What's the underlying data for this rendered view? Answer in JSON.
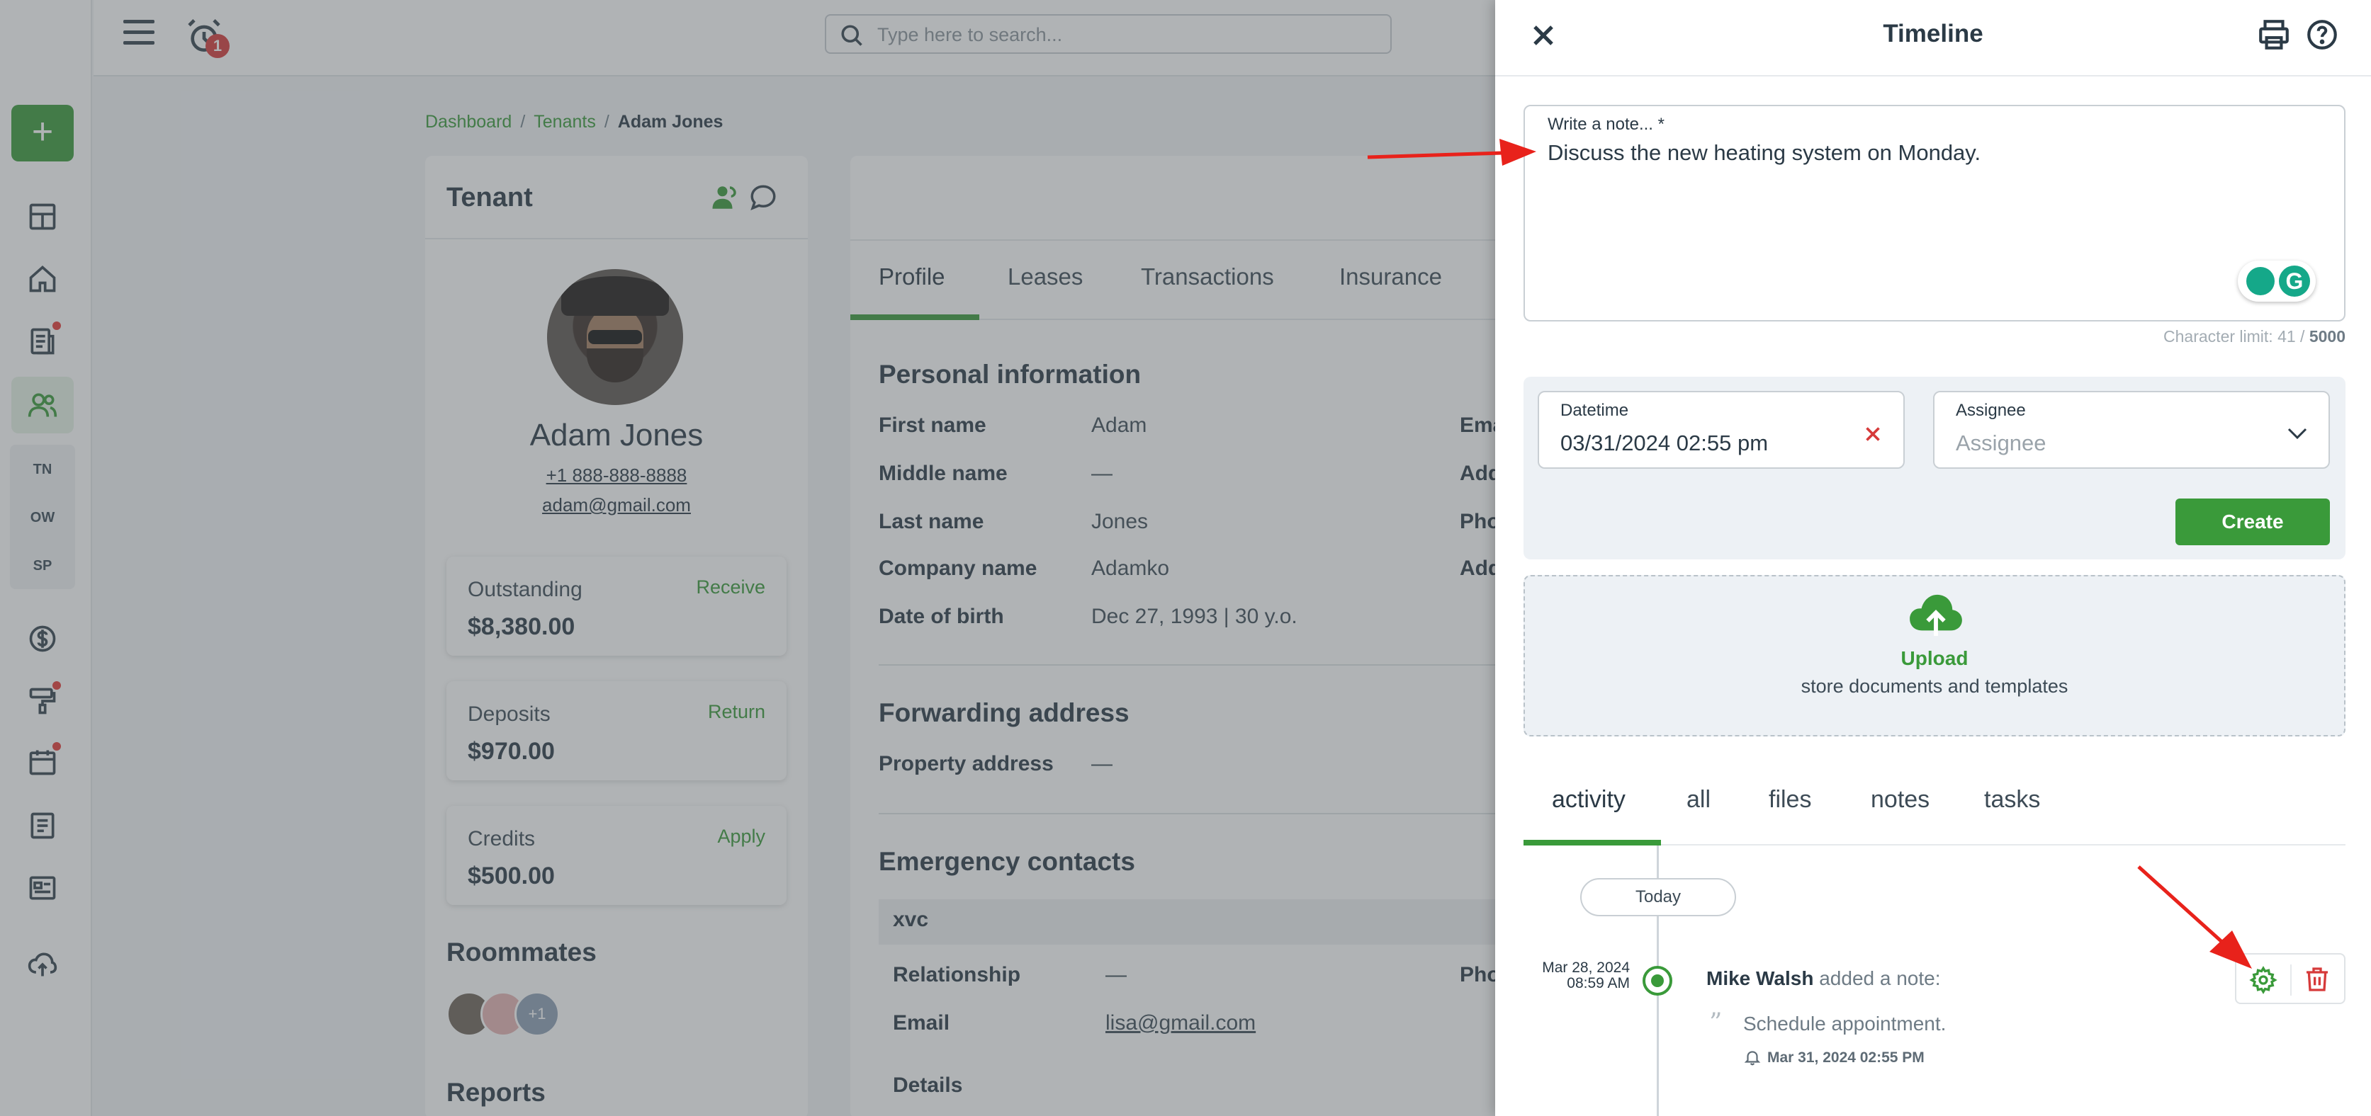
{
  "topbar": {
    "notification_count": "1",
    "search_placeholder": "Type here to search..."
  },
  "sidebar": {
    "add_label": "+",
    "sub_items": [
      "TN",
      "OW",
      "SP"
    ]
  },
  "breadcrumb": {
    "items": [
      "Dashboard",
      "Tenants"
    ],
    "current": "Adam Jones"
  },
  "tenant_card": {
    "title": "Tenant",
    "name": "Adam Jones",
    "phone": "+1 888-888-8888",
    "email": "adam@gmail.com",
    "outstanding": {
      "label": "Outstanding",
      "action": "Receive",
      "value": "$8,380.00"
    },
    "deposits": {
      "label": "Deposits",
      "action": "Return",
      "value": "$970.00"
    },
    "credits": {
      "label": "Credits",
      "action": "Apply",
      "value": "$500.00"
    },
    "roommates_title": "Roommates",
    "roommates_more": "+1",
    "reports_title": "Reports"
  },
  "profile": {
    "tabs": [
      "Profile",
      "Leases",
      "Transactions",
      "Insurance"
    ],
    "active_tab": "Profile",
    "personal_title": "Personal information",
    "personal_rows": [
      {
        "label": "First name",
        "value": "Adam"
      },
      {
        "label": "Middle name",
        "value": "—"
      },
      {
        "label": "Last name",
        "value": "Jones"
      },
      {
        "label": "Company name",
        "value": "Adamko"
      },
      {
        "label": "Date of birth",
        "value": "Dec 27, 1993 | 30 y.o."
      }
    ],
    "right_cut_labels": [
      "Ema",
      "Add",
      "Pho",
      "Add"
    ],
    "forwarding_title": "Forwarding address",
    "forwarding_label": "Property address",
    "forwarding_value": "—",
    "emergency_title": "Emergency contacts",
    "contact_name": "xvc",
    "contact_rows": [
      {
        "label": "Relationship",
        "value": "—"
      },
      {
        "label": "Email",
        "value": "lisa@gmail.com"
      }
    ],
    "contact_phone_cut": "Pho",
    "details_label": "Details"
  },
  "timeline": {
    "title": "Timeline",
    "note_label": "Write a note... *",
    "note_value": "Discuss the new heating system on Monday.",
    "char_limit_prefix": "Character limit: 41 /",
    "char_limit_max": "5000",
    "datetime_label": "Datetime",
    "datetime_value": "03/31/2024 02:55 pm",
    "assignee_label": "Assignee",
    "assignee_placeholder": "Assignee",
    "create_label": "Create",
    "upload_title": "Upload",
    "upload_sub": "store documents and templates",
    "tabs": [
      "activity",
      "all",
      "files",
      "notes",
      "tasks"
    ],
    "active_tab": "activity",
    "today_label": "Today",
    "entry": {
      "date": "Mar 28, 2024",
      "time": "08:59 AM",
      "author": "Mike Walsh",
      "action": "added a note:",
      "note": "Schedule appointment.",
      "reminder": "Mar 31, 2024 02:55 PM"
    }
  },
  "colors": {
    "accent": "#3a9a3a",
    "danger": "#d63a3a",
    "annotation_arrow": "#e8221b"
  }
}
